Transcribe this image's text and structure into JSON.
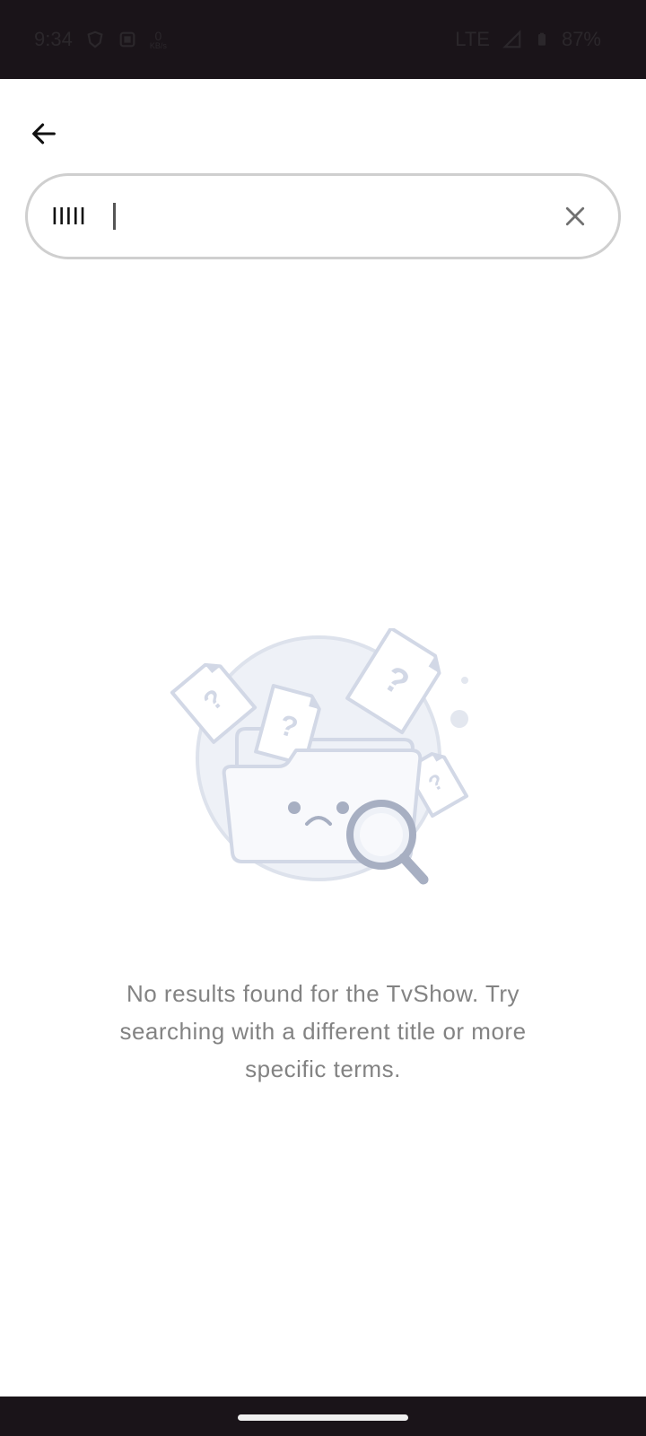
{
  "status_bar": {
    "time": "9:34",
    "net_speed_value": "0",
    "net_speed_unit": "KB/s",
    "network": "LTE",
    "battery": "87%"
  },
  "search": {
    "query": "IIIII"
  },
  "empty_state": {
    "message": "No results found for the TvShow. Try searching with a different title or more specific terms."
  },
  "icons": {
    "back": "arrow-left-icon",
    "clear": "close-icon",
    "illustration": "empty-folder-search-icon"
  },
  "colors": {
    "status_bar_bg": "#1a1419",
    "search_border": "#cfcfcf",
    "message_text": "#838383",
    "illustration_stroke": "#d2d8e6",
    "illustration_fill": "#eef1f7"
  }
}
